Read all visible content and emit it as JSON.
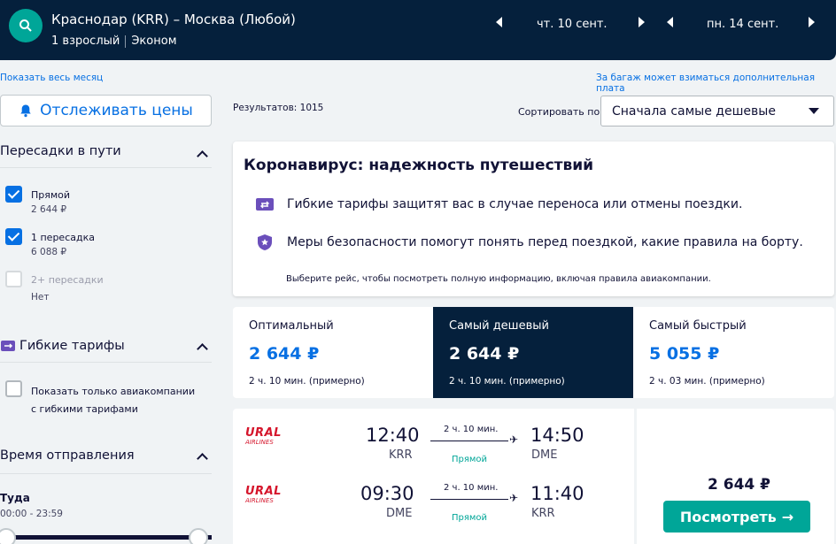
{
  "header": {
    "route": "Краснодар (KRR) – Москва (Любой)",
    "passengers": "1 взрослый",
    "cabin": "Эконом",
    "depart_date": "чт. 10 сент.",
    "return_date": "пн. 14 сент.",
    "accent": "#00a698",
    "bg": "#05203c"
  },
  "links": {
    "show_month": "Показать весь месяц",
    "baggage_note": "За багаж может взиматься дополнительная плата"
  },
  "sidebar": {
    "track_button": "Отслеживать цены",
    "stops": {
      "title": "Пересадки в пути",
      "options": [
        {
          "label": "Прямой",
          "price": "2 644 ₽",
          "checked": true
        },
        {
          "label": "1 пересадка",
          "price": "6 088 ₽",
          "checked": true
        },
        {
          "label": "2+ пересадки",
          "price": "Нет",
          "checked": false
        }
      ]
    },
    "flexible": {
      "title": "Гибкие тарифы",
      "option": "Показать только авиакомпании с гибкими тарифами"
    },
    "departure_time": {
      "title": "Время отправления",
      "label": "Туда",
      "range": "00:00 - 23:59"
    }
  },
  "main": {
    "results": "Результатов: 1015",
    "sort_label": "Сортировать по",
    "sort_value": "Сначала самые дешевые",
    "covid": {
      "title": "Коронавирус: надежность путешествий",
      "line1": "Гибкие тарифы защитят вас в случае переноса или отмены поездки.",
      "line2": "Меры безопасности помогут понять перед поездкой, какие правила на борту.",
      "note": "Выберите рейс, чтобы посмотреть полную информацию, включая правила авиакомпании."
    },
    "tabs": [
      {
        "name": "Оптимальный",
        "price": "2 644 ₽",
        "duration": "2 ч. 10 мин. (примерно)"
      },
      {
        "name": "Самый дешевый",
        "price": "2 644 ₽",
        "duration": "2 ч. 10 мин. (примерно)"
      },
      {
        "name": "Самый быстрый",
        "price": "5 055 ₽",
        "duration": "2 ч. 03 мин. (примерно)"
      }
    ],
    "ticket": {
      "airline_name": "URAL",
      "airline_sub": "AIRLINES",
      "outbound": {
        "dep": "12:40",
        "dep_code": "KRR",
        "arr": "14:50",
        "arr_code": "DME",
        "duration": "2 ч. 10 мин.",
        "stops": "Прямой"
      },
      "inbound": {
        "dep": "09:30",
        "dep_code": "DME",
        "arr": "11:40",
        "arr_code": "KRR",
        "duration": "2 ч. 10 мин.",
        "stops": "Прямой"
      },
      "price": "2 644 ₽",
      "button": "Посмотреть"
    }
  }
}
